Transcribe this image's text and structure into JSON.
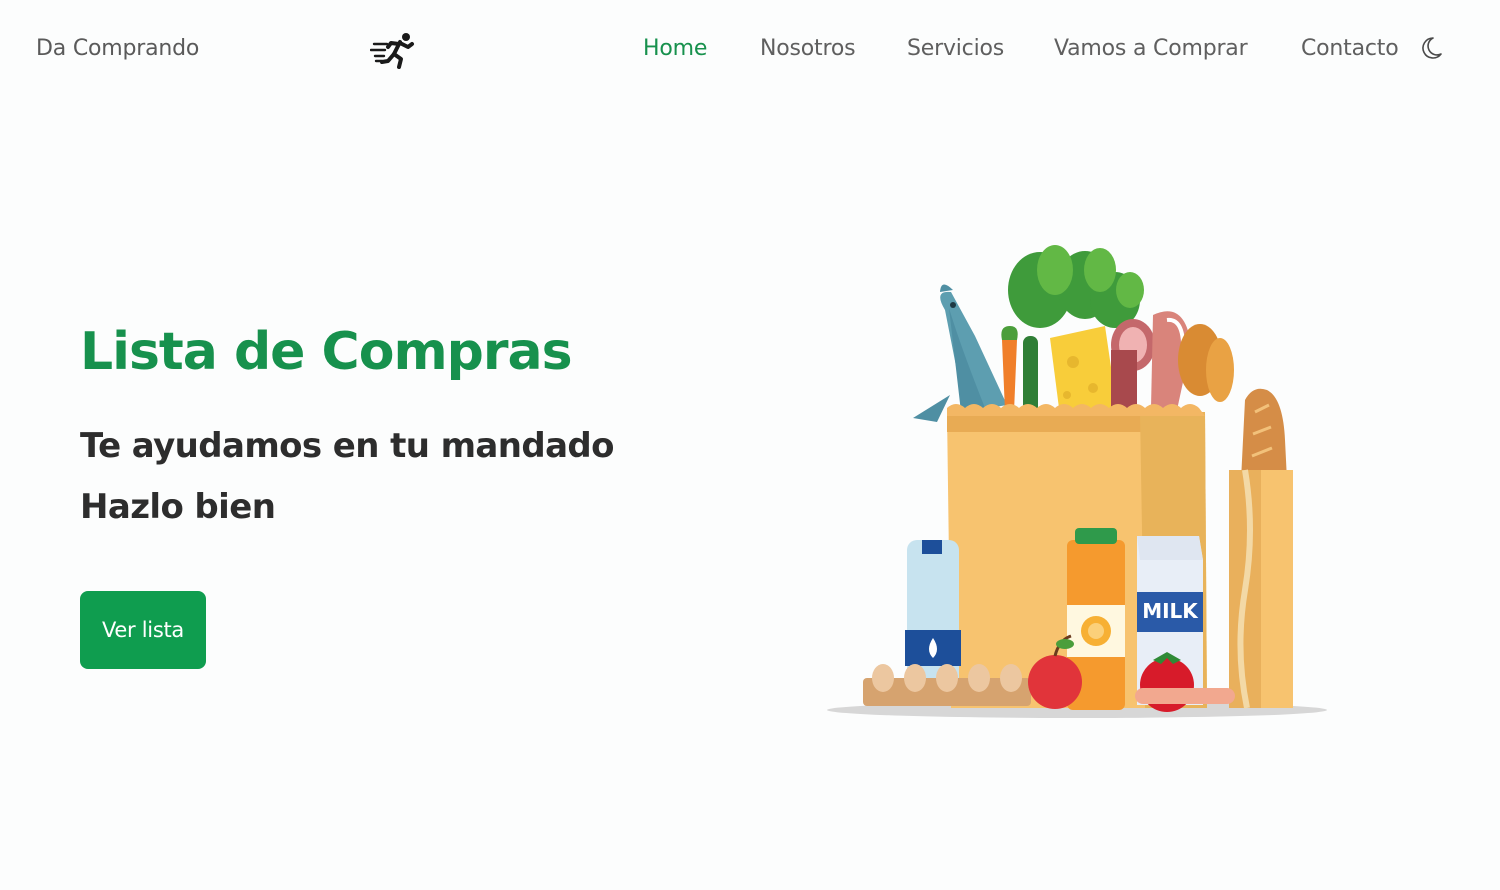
{
  "navbar": {
    "brand": "Da Comprando",
    "logo_icon": "running-person-icon",
    "links": [
      {
        "label": "Home",
        "active": true
      },
      {
        "label": "Nosotros",
        "active": false
      },
      {
        "label": "Servicios",
        "active": false
      },
      {
        "label": "Vamos a Comprar",
        "active": false
      },
      {
        "label": "Contacto",
        "active": false
      }
    ],
    "theme_toggle_icon": "moon-icon"
  },
  "hero": {
    "title": "Lista de Compras",
    "line1": "Te ayudamos en tu mandado",
    "line2": "Hazlo bien",
    "button_label": "Ver lista",
    "image_label": "MILK"
  },
  "colors": {
    "accent": "#17914d",
    "button": "#0f9d4f",
    "text_dark": "#2d2d2d",
    "nav_text": "#5f5f5f",
    "background": "#fcfdfd"
  }
}
